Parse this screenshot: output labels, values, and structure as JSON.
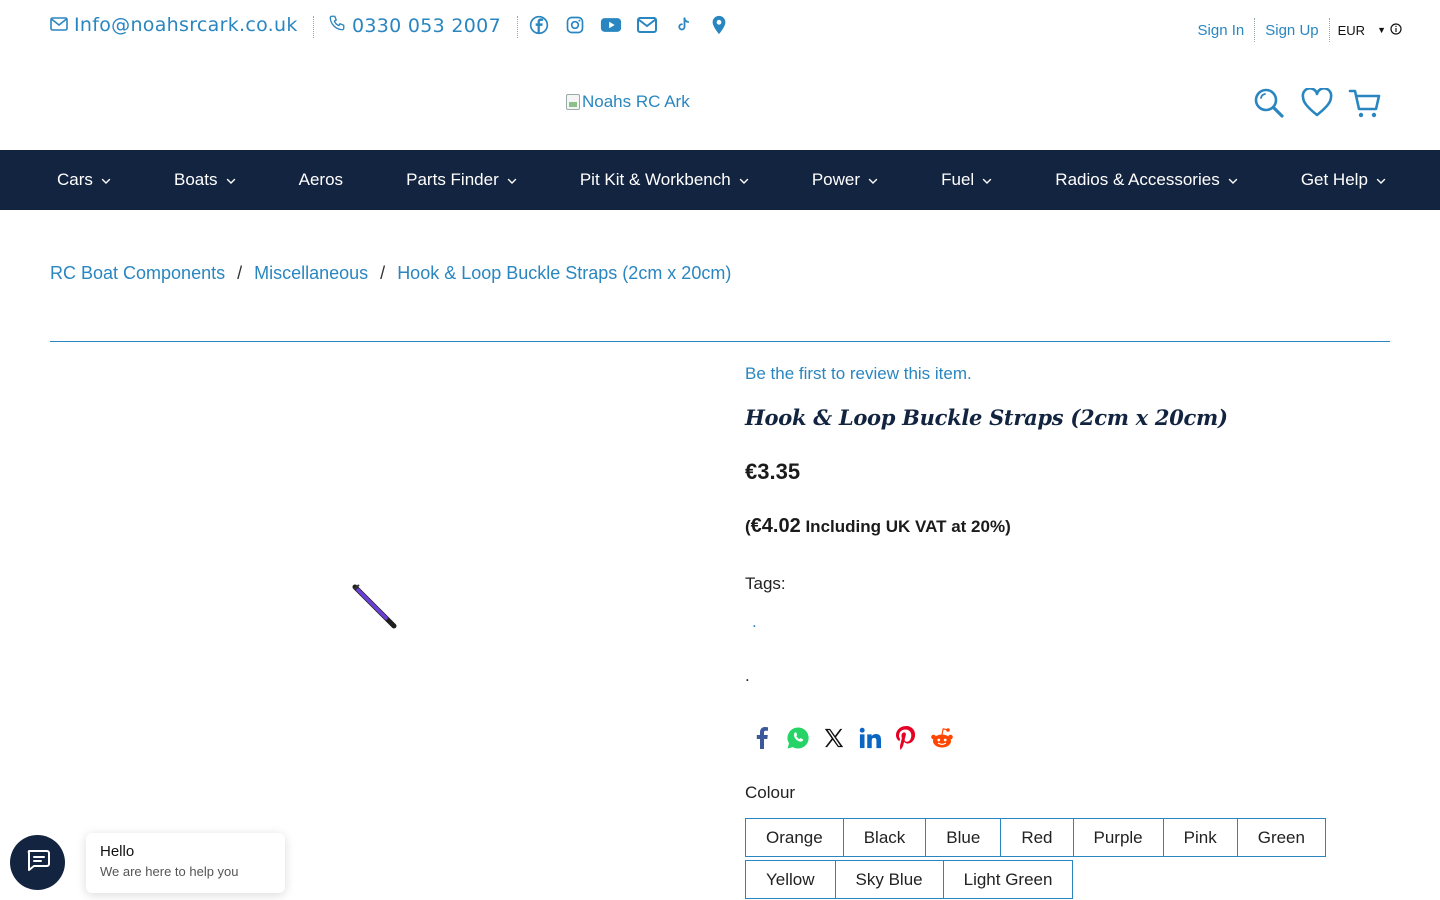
{
  "topbar": {
    "email": "Info@noahsrcark.co.uk",
    "phone": "0330 053 2007",
    "social": [
      "facebook-icon",
      "instagram-icon",
      "youtube-icon",
      "mail-icon",
      "tiktok-icon",
      "location-pin-icon"
    ],
    "sign_in": "Sign In",
    "sign_up": "Sign Up",
    "currency": "EUR"
  },
  "header": {
    "logo_alt": "Noahs RC Ark"
  },
  "nav": {
    "items": [
      {
        "label": "Cars",
        "dropdown": true
      },
      {
        "label": "Boats",
        "dropdown": true
      },
      {
        "label": "Aeros",
        "dropdown": false
      },
      {
        "label": "Parts Finder",
        "dropdown": true
      },
      {
        "label": "Pit Kit & Workbench",
        "dropdown": true
      },
      {
        "label": "Power",
        "dropdown": true
      },
      {
        "label": "Fuel",
        "dropdown": true
      },
      {
        "label": "Radios & Accessories",
        "dropdown": true
      },
      {
        "label": "Get Help",
        "dropdown": true
      }
    ]
  },
  "breadcrumb": {
    "items": [
      "RC Boat Components",
      "Miscellaneous",
      "Hook & Loop Buckle Straps (2cm x 20cm)"
    ],
    "separator": "/"
  },
  "product": {
    "review_link": "Be the first to review this item.",
    "title": "Hook & Loop Buckle Straps (2cm x 20cm)",
    "price": "€3.35",
    "vat_open": "(",
    "vat_price": "€4.02",
    "vat_text": " Including UK VAT at 20%)",
    "tags_label": "Tags:",
    "tag_dot": ".",
    "desc_dot": ".",
    "share": [
      "facebook-icon",
      "whatsapp-icon",
      "x-icon",
      "linkedin-icon",
      "pinterest-icon",
      "reddit-icon"
    ],
    "colour_label": "Colour",
    "colours_row1": [
      "Orange",
      "Black",
      "Blue",
      "Red",
      "Purple",
      "Pink",
      "Green"
    ],
    "colours_row2": [
      "Yellow",
      "Sky Blue",
      "Light Green"
    ]
  },
  "chat": {
    "title": "Hello",
    "subtitle": "We are here to help you"
  },
  "colors": {
    "accent": "#2a86c0",
    "navy": "#132440"
  }
}
